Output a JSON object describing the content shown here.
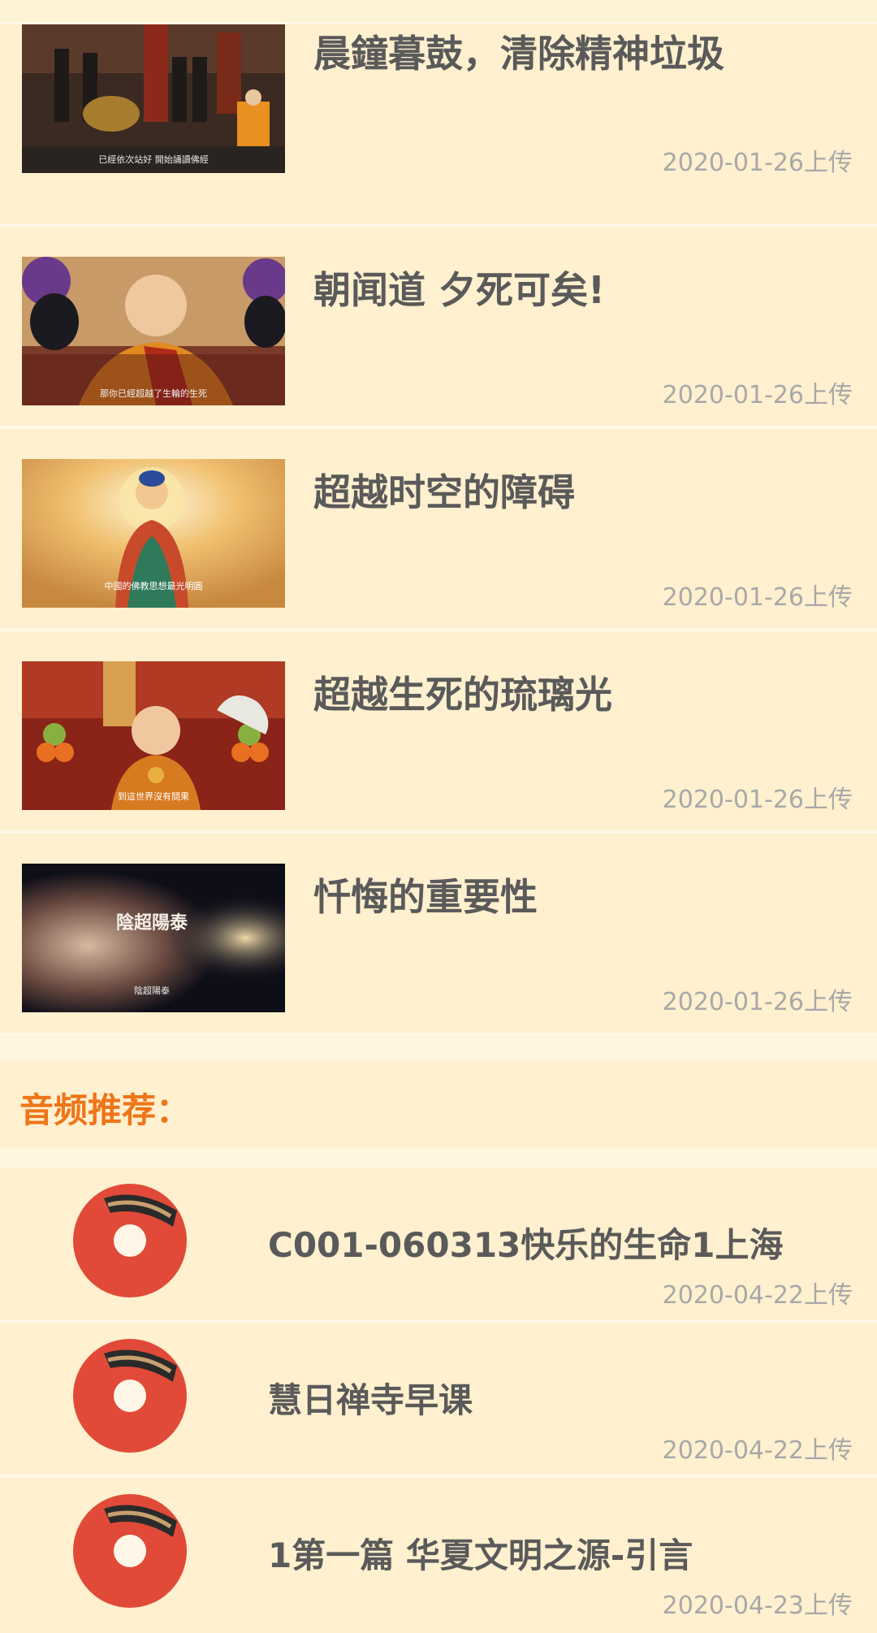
{
  "videos": [
    {
      "title": "晨鐘暮鼓，清除精神垃圾",
      "date": "2020-01-26上传",
      "thumb_caption": "已經依次站好 開始誦讀佛經"
    },
    {
      "title": "朝闻道 夕死可矣!",
      "date": "2020-01-26上传",
      "thumb_caption": "那你已經超越了生輪的生死"
    },
    {
      "title": "超越时空的障碍",
      "date": "2020-01-26上传",
      "thumb_caption": "中國的佛教思想最光明圓"
    },
    {
      "title": "超越生死的琉璃光",
      "date": "2020-01-26上传",
      "thumb_caption": "到這世界沒有間果"
    },
    {
      "title": "忏悔的重要性",
      "date": "2020-01-26上传",
      "thumb_caption": "陰超陽泰",
      "thumb_overlay": "陰超陽泰"
    }
  ],
  "audio_section": {
    "title": "音频推荐："
  },
  "audios": [
    {
      "title": "C001-060313快乐的生命1上海",
      "date": "2020-04-22上传"
    },
    {
      "title": "慧日禅寺早课",
      "date": "2020-04-22上传"
    },
    {
      "title": "1第一篇 华夏文明之源-引言",
      "date": "2020-04-23上传"
    }
  ],
  "colors": {
    "background": "#fff0cf",
    "accent": "#ee7519",
    "text": "#5a5a5a",
    "muted": "#a8a8a8",
    "disc": "#e04e39"
  }
}
